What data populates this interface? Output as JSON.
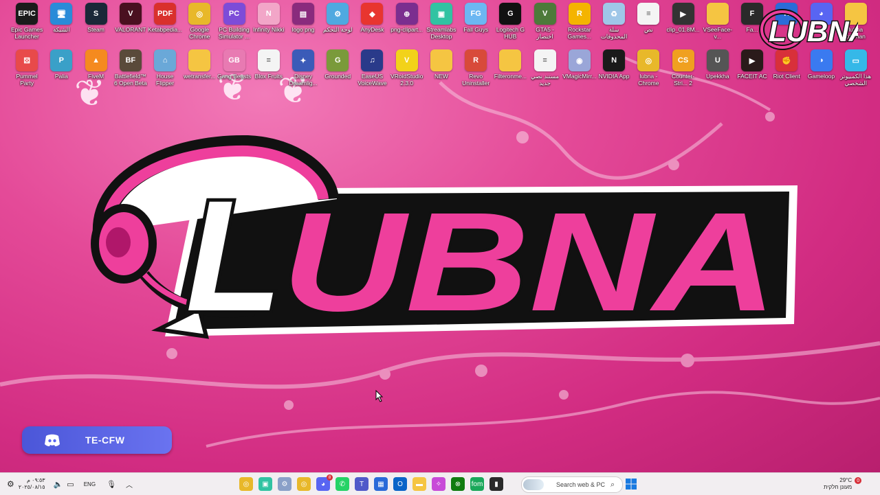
{
  "desktop": {
    "row1": [
      {
        "label": "Epic Games Launcher",
        "icon": "epic-games-icon",
        "color": "#1b1b1b",
        "glyph": "EPIC"
      },
      {
        "label": "الشبكة",
        "icon": "network-icon",
        "color": "#2a8bd8",
        "glyph": "🖥"
      },
      {
        "label": "Steam",
        "icon": "steam-icon",
        "color": "#1b2838",
        "glyph": "S"
      },
      {
        "label": "VALORANT",
        "icon": "valorant-icon",
        "color": "#4a1020",
        "glyph": "V"
      },
      {
        "label": "Ketabpedia...",
        "icon": "pdf-icon",
        "color": "#d9302c",
        "glyph": "PDF"
      },
      {
        "label": "Google Chrome",
        "icon": "chrome-icon",
        "color": "#e8b82a",
        "glyph": "◎"
      },
      {
        "label": "PC Building Simulator ...",
        "icon": "pc-building-icon",
        "color": "#7d4cd8",
        "glyph": "PC"
      },
      {
        "label": "Infinity Nikki",
        "icon": "infinity-nikki-icon",
        "color": "#f2a6c8",
        "glyph": "N"
      },
      {
        "label": "logo png",
        "icon": "winrar-icon",
        "color": "#8a2b7d",
        "glyph": "▤"
      },
      {
        "label": "لوحة التحكم",
        "icon": "control-panel-icon",
        "color": "#4fa9e0",
        "glyph": "⚙"
      },
      {
        "label": "AnyDesk",
        "icon": "anydesk-icon",
        "color": "#e8352f",
        "glyph": "◆"
      },
      {
        "label": "png-clipart...",
        "icon": "web-file-icon",
        "color": "#7b2e8f",
        "glyph": "⊕"
      },
      {
        "label": "Streamlabs Desktop",
        "icon": "streamlabs-icon",
        "color": "#31c3a2",
        "glyph": "▣"
      },
      {
        "label": "Fall Guys",
        "icon": "fall-guys-icon",
        "color": "#6cb7f2",
        "glyph": "FG"
      },
      {
        "label": "Logitech G HUB",
        "icon": "logitech-icon",
        "color": "#111111",
        "glyph": "G"
      },
      {
        "label": "GTA5 - اختصار",
        "icon": "gta-icon",
        "color": "#4d7a3a",
        "glyph": "V"
      },
      {
        "label": "Rockstar Games...",
        "icon": "rockstar-icon",
        "color": "#f4b400",
        "glyph": "R"
      },
      {
        "label": "سلة المحذوفات",
        "icon": "recycle-bin-icon",
        "color": "#9fc7e8",
        "glyph": "♻"
      },
      {
        "label": "نص",
        "icon": "text-file-icon",
        "color": "#f4f4f4",
        "glyph": "≡"
      },
      {
        "label": "clip_01.8M...",
        "icon": "video-file-icon",
        "color": "#333333",
        "glyph": "▶"
      },
      {
        "label": "VSeeFace-v...",
        "icon": "folder-icon",
        "color": "#f5c542",
        "glyph": ""
      },
      {
        "label": "Fa...",
        "icon": "app-icon",
        "color": "#2a2a2a",
        "glyph": "F"
      },
      {
        "label": "",
        "icon": "rocket-league-icon",
        "color": "#2b6cd8",
        "glyph": "R"
      },
      {
        "label": "",
        "icon": "discord-icon",
        "color": "#5865f2",
        "glyph": "◕"
      },
      {
        "label": "lubna othman",
        "icon": "folder-icon",
        "color": "#f5c542",
        "glyph": ""
      }
    ],
    "row2": [
      {
        "label": "Pummel Party",
        "icon": "pummel-party-icon",
        "color": "#e84a4a",
        "glyph": "⚄"
      },
      {
        "label": "Palia",
        "icon": "palia-icon",
        "color": "#3aa0c8",
        "glyph": "P"
      },
      {
        "label": "FiveM",
        "icon": "fivem-icon",
        "color": "#f58a1f",
        "glyph": "▲"
      },
      {
        "label": "Battlefield™ 6 Open Beta",
        "icon": "battlefield-icon",
        "color": "#5a4a3a",
        "glyph": "BF"
      },
      {
        "label": "House Flipper",
        "icon": "house-flipper-icon",
        "color": "#6aa8d8",
        "glyph": "⌂"
      },
      {
        "label": "wetransfer...",
        "icon": "folder-zip-icon",
        "color": "#f5c542",
        "glyph": ""
      },
      {
        "label": "Gang Beasts",
        "icon": "gang-beasts-icon",
        "color": "#e87ab2",
        "glyph": "GB"
      },
      {
        "label": "Blox Fruits",
        "icon": "text-file-icon",
        "color": "#f4f4f4",
        "glyph": "≡"
      },
      {
        "label": "Disney Dreamlig...",
        "icon": "disney-icon",
        "color": "#3b5bb8",
        "glyph": "✦"
      },
      {
        "label": "Grounded",
        "icon": "grounded-icon",
        "color": "#7a9a3a",
        "glyph": "G"
      },
      {
        "label": "EaseUS VoiceWave",
        "icon": "easeus-icon",
        "color": "#2a3a8a",
        "glyph": "♫"
      },
      {
        "label": "VRoidStudio 2.3.0",
        "icon": "vroid-icon",
        "color": "#f2d21a",
        "glyph": "V"
      },
      {
        "label": "NEW",
        "icon": "folder-icon",
        "color": "#f5c542",
        "glyph": ""
      },
      {
        "label": "Revo Uninstaller",
        "icon": "revo-icon",
        "color": "#d84a3a",
        "glyph": "R"
      },
      {
        "label": "Filteronme...",
        "icon": "folder-icon",
        "color": "#f5c542",
        "glyph": ""
      },
      {
        "label": "مستند نصي جديد",
        "icon": "text-file-icon",
        "color": "#f4f4f4",
        "glyph": "≡"
      },
      {
        "label": "VMagicMirr...",
        "icon": "vmagicmirror-icon",
        "color": "#9aa6d8",
        "glyph": "◉"
      },
      {
        "label": "NVIDIA App",
        "icon": "nvidia-icon",
        "color": "#1a1a1a",
        "glyph": "N"
      },
      {
        "label": "lubna - Chrome",
        "icon": "chrome-profile-icon",
        "color": "#e8b82a",
        "glyph": "◎"
      },
      {
        "label": "Counter-Stri... 2",
        "icon": "cs2-icon",
        "color": "#f0a020",
        "glyph": "CS"
      },
      {
        "label": "Upekkha",
        "icon": "upekkha-icon",
        "color": "#555555",
        "glyph": "U"
      },
      {
        "label": "FACEIT AC",
        "icon": "faceit-icon",
        "color": "#2a1a1a",
        "glyph": "▶"
      },
      {
        "label": "Riot Client",
        "icon": "riot-icon",
        "color": "#d8303a",
        "glyph": "✊"
      },
      {
        "label": "Gameloop",
        "icon": "gameloop-icon",
        "color": "#3a7af0",
        "glyph": "◑"
      },
      {
        "label": "هذا الكمبيوتر الشخصي",
        "icon": "this-pc-icon",
        "color": "#35b8e8",
        "glyph": "▭"
      }
    ],
    "wallpaper_logo": {
      "text": "LUBNA",
      "letter": "L"
    },
    "corner_logo": {
      "text": "LUBNA"
    }
  },
  "discord_widget": {
    "name": "TE-CFW"
  },
  "taskbar": {
    "date": "٢٠٢٥/٠٨/١٥",
    "time": "٠٩:٥٣ م",
    "language": "ENG",
    "search_placeholder": "Search web & PC",
    "weather_temp": "29°C",
    "weather_desc": "מעונן חלקית",
    "notification_count": "0",
    "app_badge": "8",
    "pinned": [
      {
        "icon": "chrome-icon",
        "color": "#e8b82a",
        "glyph": "◎"
      },
      {
        "icon": "streamlabs-icon",
        "color": "#31c3a2",
        "glyph": "▣"
      },
      {
        "icon": "settings-icon",
        "color": "#8aa0c8",
        "glyph": "⚙"
      },
      {
        "icon": "chrome-icon",
        "color": "#e8b82a",
        "glyph": "◎"
      },
      {
        "icon": "discord-icon",
        "color": "#5865f2",
        "glyph": "◕"
      },
      {
        "icon": "whatsapp-icon",
        "color": "#25d366",
        "glyph": "✆"
      },
      {
        "icon": "teams-icon",
        "color": "#5059c9",
        "glyph": "T"
      },
      {
        "icon": "store-icon",
        "color": "#2a6ad8",
        "glyph": "▦"
      },
      {
        "icon": "outlook-icon",
        "color": "#0a64c8",
        "glyph": "O"
      },
      {
        "icon": "file-explorer-icon",
        "color": "#f5c542",
        "glyph": "▬"
      },
      {
        "icon": "copilot-icon",
        "color": "#c84ad8",
        "glyph": "✧"
      },
      {
        "icon": "xbox-icon",
        "color": "#107c10",
        "glyph": "⊗"
      },
      {
        "icon": "fom-icon",
        "color": "#1aa85a",
        "glyph": "fom"
      },
      {
        "icon": "terminal-icon",
        "color": "#2a2a2a",
        "glyph": "▮"
      }
    ]
  },
  "colors": {
    "accent": "#ee3f9c",
    "wallpaper": "#d22c82",
    "discord": "#5865f2",
    "taskbar": "#f2eef1"
  }
}
